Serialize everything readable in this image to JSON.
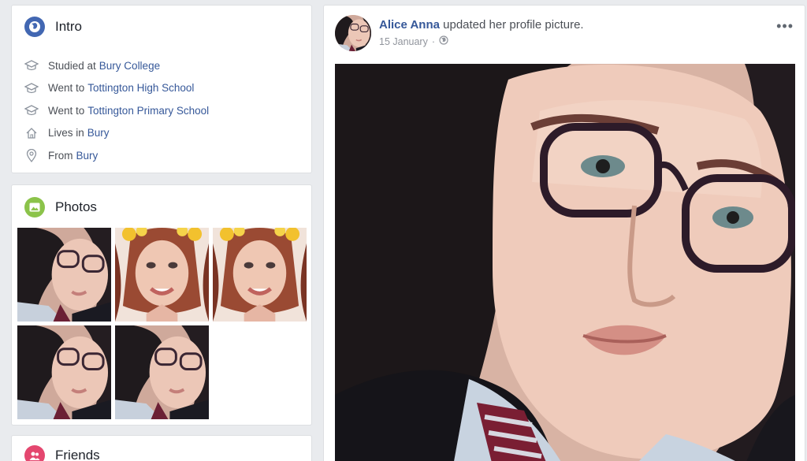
{
  "intro": {
    "title": "Intro",
    "items": [
      {
        "icon": "graduation-cap-icon",
        "prefix": "Studied at",
        "link": "Bury College"
      },
      {
        "icon": "graduation-cap-icon",
        "prefix": "Went to",
        "link": "Tottington High School"
      },
      {
        "icon": "graduation-cap-icon",
        "prefix": "Went to",
        "link": "Tottington Primary School"
      },
      {
        "icon": "home-icon",
        "prefix": "Lives in",
        "link": "Bury"
      },
      {
        "icon": "location-pin-icon",
        "prefix": "From",
        "link": "Bury"
      }
    ]
  },
  "photos": {
    "title": "Photos",
    "count": 5
  },
  "friends": {
    "title": "Friends"
  },
  "post": {
    "author": "Alice Anna",
    "action": "updated her profile picture.",
    "date": "15 January",
    "separator": "·",
    "audience_icon": "globe-icon",
    "more_label": "•••"
  },
  "colors": {
    "link": "#365899",
    "intro_icon": "#4267b2",
    "photos_icon": "#8bc34a",
    "friends_icon": "#e4476f"
  }
}
